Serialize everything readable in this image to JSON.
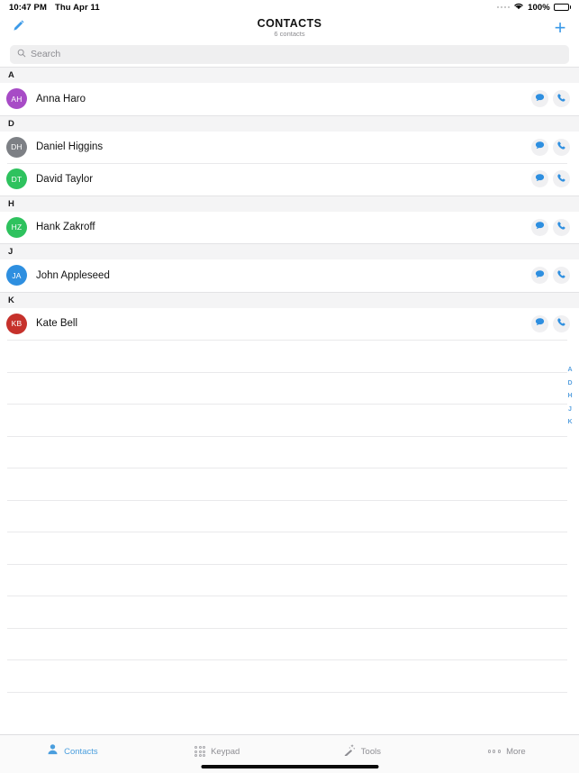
{
  "status_bar": {
    "time": "10:47 PM",
    "date": "Thu Apr 11",
    "battery_percent": "100%",
    "wifi_icon": "wifi-icon",
    "signal_icon": "signal-dots-icon",
    "battery_icon": "battery-full-icon"
  },
  "nav": {
    "title": "CONTACTS",
    "subtitle": "6 contacts",
    "edit_icon": "pencil-icon",
    "add_icon": "plus-icon",
    "add_label": "+"
  },
  "search": {
    "placeholder": "Search",
    "icon": "search-icon"
  },
  "colors": {
    "accent": "#3c9ae8",
    "index_blue": "#5aa2e0",
    "section_bg": "#f4f4f5",
    "separator": "#e9e9eb",
    "action_bg": "#f0f0f2",
    "tab_inactive": "#8e8e93",
    "tab_active": "#4a9ede"
  },
  "sections": [
    {
      "letter": "A",
      "contacts": [
        {
          "initials": "AH",
          "name": "Anna Haro",
          "color": "#a74bc6",
          "message_icon": "message-bubble-icon",
          "call_icon": "phone-icon"
        }
      ]
    },
    {
      "letter": "D",
      "contacts": [
        {
          "initials": "DH",
          "name": "Daniel Higgins",
          "color": "#7d8085",
          "message_icon": "message-bubble-icon",
          "call_icon": "phone-icon"
        },
        {
          "initials": "DT",
          "name": "David Taylor",
          "color": "#2ec25e",
          "message_icon": "message-bubble-icon",
          "call_icon": "phone-icon"
        }
      ]
    },
    {
      "letter": "H",
      "contacts": [
        {
          "initials": "HZ",
          "name": "Hank Zakroff",
          "color": "#2ec25e",
          "message_icon": "message-bubble-icon",
          "call_icon": "phone-icon"
        }
      ]
    },
    {
      "letter": "J",
      "contacts": [
        {
          "initials": "JA",
          "name": "John Appleseed",
          "color": "#2e8fe0",
          "message_icon": "message-bubble-icon",
          "call_icon": "phone-icon"
        }
      ]
    },
    {
      "letter": "K",
      "contacts": [
        {
          "initials": "KB",
          "name": "Kate Bell",
          "color": "#c6312b",
          "message_icon": "message-bubble-icon",
          "call_icon": "phone-icon"
        }
      ]
    }
  ],
  "index_letters": [
    "A",
    "D",
    "H",
    "J",
    "K"
  ],
  "empty_row_count": 12,
  "tabs": [
    {
      "label": "Contacts",
      "icon": "person-icon",
      "active": true
    },
    {
      "label": "Keypad",
      "icon": "keypad-grid-icon",
      "active": false
    },
    {
      "label": "Tools",
      "icon": "magic-wand-icon",
      "active": false
    },
    {
      "label": "More",
      "icon": "ellipsis-icon",
      "active": false
    }
  ]
}
